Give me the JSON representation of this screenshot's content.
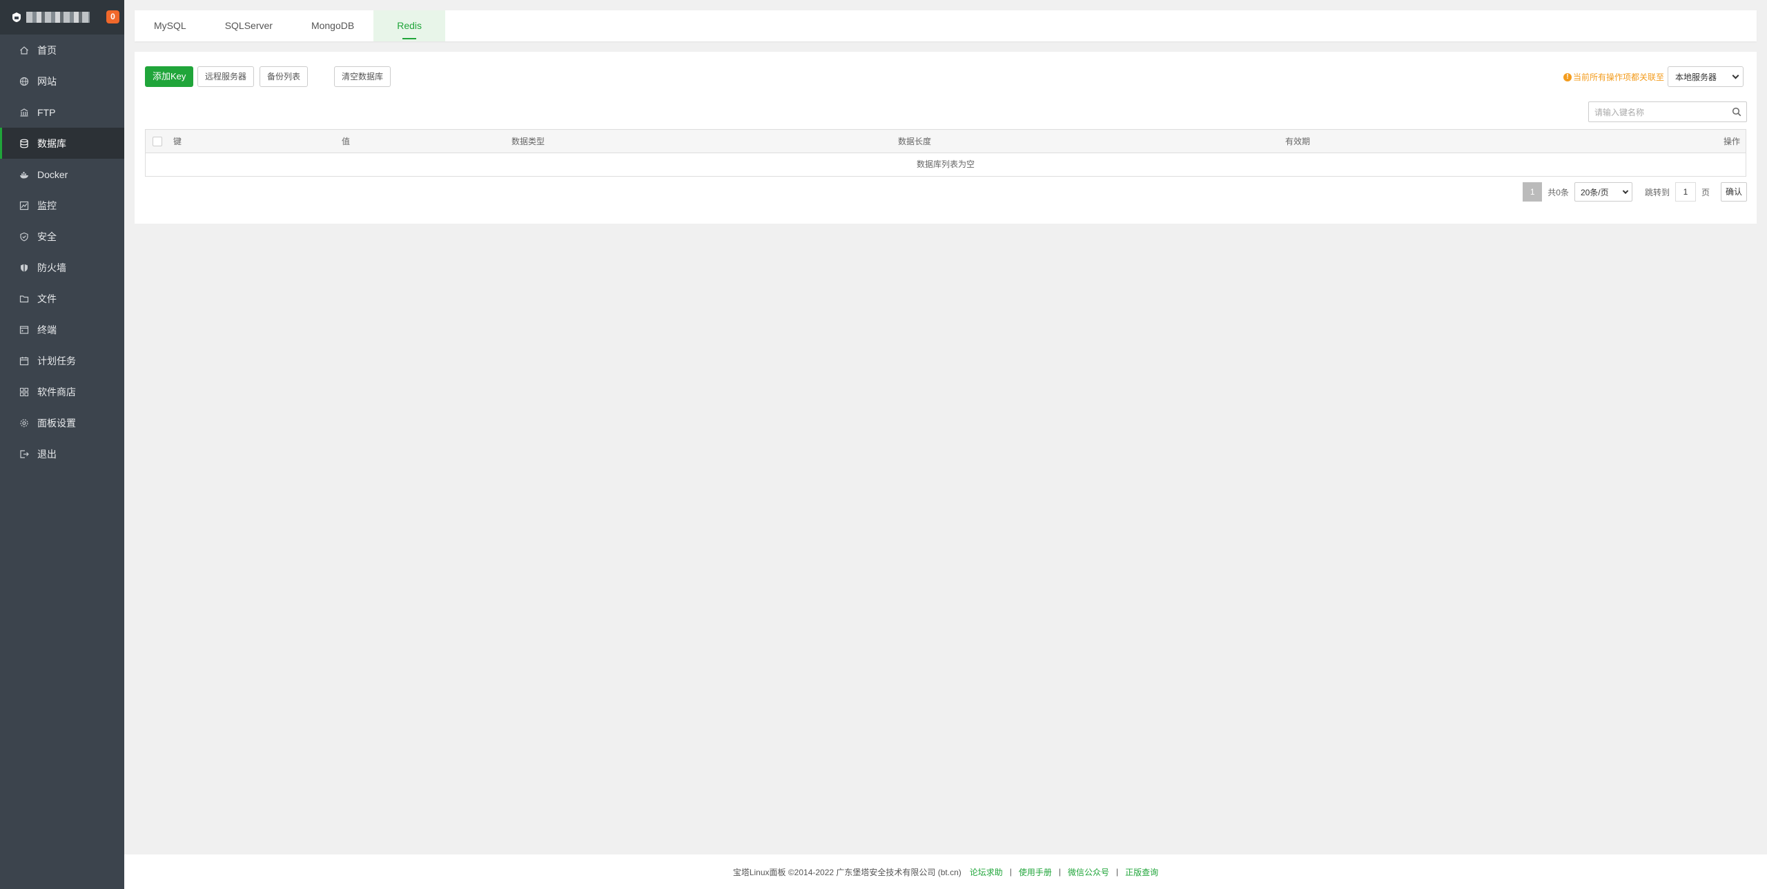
{
  "sidebar": {
    "badge": "0",
    "items": [
      {
        "label": "首页",
        "icon": "home-icon"
      },
      {
        "label": "网站",
        "icon": "globe-icon"
      },
      {
        "label": "FTP",
        "icon": "ftp-icon"
      },
      {
        "label": "数据库",
        "icon": "database-icon",
        "active": true
      },
      {
        "label": "Docker",
        "icon": "docker-icon"
      },
      {
        "label": "监控",
        "icon": "monitor-icon"
      },
      {
        "label": "安全",
        "icon": "shield-icon"
      },
      {
        "label": "防火墙",
        "icon": "firewall-icon"
      },
      {
        "label": "文件",
        "icon": "folder-icon"
      },
      {
        "label": "终端",
        "icon": "terminal-icon"
      },
      {
        "label": "计划任务",
        "icon": "calendar-icon"
      },
      {
        "label": "软件商店",
        "icon": "apps-icon"
      },
      {
        "label": "面板设置",
        "icon": "gear-icon"
      },
      {
        "label": "退出",
        "icon": "logout-icon"
      }
    ]
  },
  "tabs": [
    "MySQL",
    "SQLServer",
    "MongoDB",
    "Redis"
  ],
  "active_tab": "Redis",
  "toolbar": {
    "add_key": "添加Key",
    "remote_server": "远程服务器",
    "backup_list": "备份列表",
    "clear_db": "清空数据库",
    "warning": "当前所有操作项都关联至",
    "server_select": "本地服务器",
    "search_placeholder": "请输入键名称"
  },
  "table": {
    "headers": {
      "key": "键",
      "value": "值",
      "type": "数据类型",
      "length": "数据长度",
      "ttl": "有效期",
      "action": "操作"
    },
    "empty": "数据库列表为空"
  },
  "pager": {
    "current": "1",
    "total": "共0条",
    "per_page": "20条/页",
    "jump_label": "跳转到",
    "jump_value": "1",
    "page_unit": "页",
    "confirm": "确认"
  },
  "footer": {
    "copyright": "宝塔Linux面板 ©2014-2022 广东堡塔安全技术有限公司 (bt.cn)",
    "links": [
      "论坛求助",
      "使用手册",
      "微信公众号",
      "正版查询"
    ]
  },
  "colors": {
    "accent": "#20a53a",
    "sidebar": "#3c444d",
    "warning": "#f39c1e",
    "badge": "#f0682b"
  }
}
